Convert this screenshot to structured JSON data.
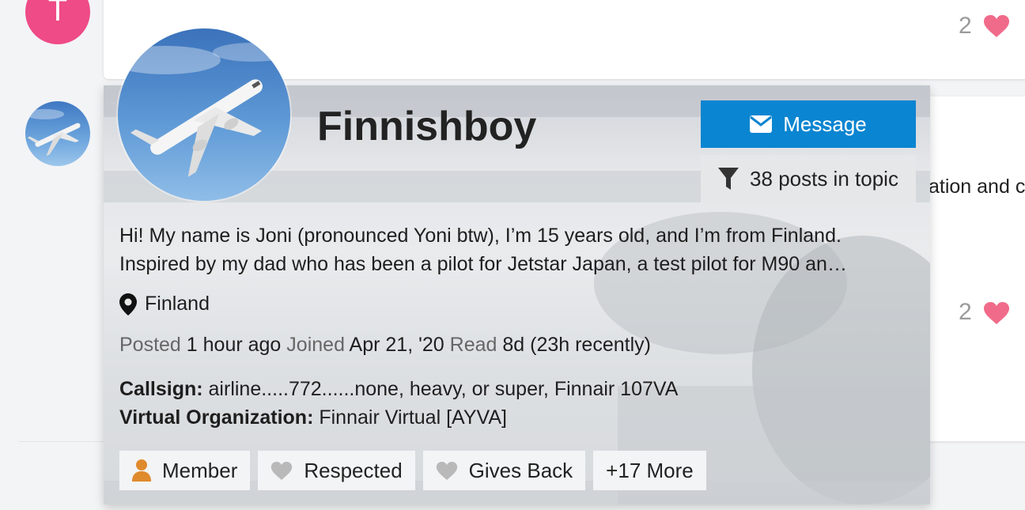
{
  "background_posts": [
    {
      "likes": "2"
    },
    {
      "likes": "2",
      "partial_text": "ation and c"
    }
  ],
  "user_card": {
    "username": "Finnishboy",
    "message_button": "Message",
    "posts_button": "38 posts in topic",
    "bio_lines": [
      "Hi! My name is Joni (pronounced Yoni btw), I’m 15 years old, and I’m from Finland.",
      "Inspired by my dad who has been a pilot for Jetstar Japan, a test pilot for M90 an…"
    ],
    "location": "Finland",
    "stats": {
      "posted_label": "Posted",
      "posted_value": "1 hour ago",
      "joined_label": "Joined",
      "joined_value": "Apr 21, '20",
      "read_label": "Read",
      "read_value": "8d (23h recently)"
    },
    "fields": [
      {
        "label": "Callsign:",
        "value": "airline.....772......none, heavy, or super, Finnair 107VA"
      },
      {
        "label": "Virtual Organization:",
        "value": "Finnair Virtual [AYVA]"
      }
    ],
    "badges": [
      {
        "label": "Member",
        "icon": "user-icon"
      },
      {
        "label": "Respected",
        "icon": "heart-icon"
      },
      {
        "label": "Gives Back",
        "icon": "heart-icon"
      },
      {
        "label": "+17 More",
        "icon": ""
      }
    ]
  },
  "colors": {
    "accent": "#0a85d1",
    "heart": "#f06b8a",
    "avatar_pink": "#ef4b86",
    "member_icon": "#e08a2e",
    "badge_heart": "#b9b9b9"
  }
}
